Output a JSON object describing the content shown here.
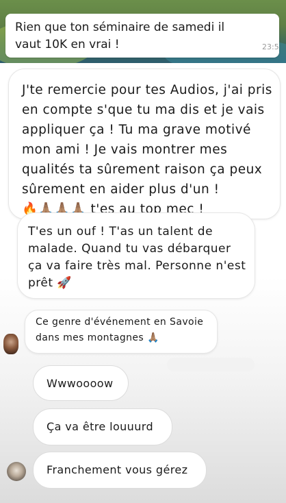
{
  "top_message": {
    "text": "Rien que ton séminaire de samedi il vaut 10K en vrai !",
    "time": "23:5"
  },
  "story_cards": [
    {
      "text": "J'te remercie pour tes Audios, j'ai pris en compte s'que tu ma dis et je vais appliquer ça ! Tu ma grave motivé mon ami ! Je vais montrer mes qualités ta sûrement raison ça peux sûrement en aider plus d'un !",
      "tail": "🔥🙏🏽🙏🏽🙏🏽 t'es au top mec !"
    },
    {
      "text": "T'es un ouf ! T'as un talent de malade. Quand tu vas débarquer ça va faire très mal. Personne n'est prêt 🚀"
    },
    {
      "text": "Ce genre d'événement en Savoie dans mes montagnes 🙏🏽"
    }
  ],
  "replies": [
    {
      "text": "Wwwoooow"
    },
    {
      "text": "Ça va être louuurd"
    },
    {
      "text": "Franchement vous gérez"
    }
  ],
  "icons": [
    "avatar",
    "fire-emoji",
    "pray-emoji",
    "rocket-emoji"
  ]
}
